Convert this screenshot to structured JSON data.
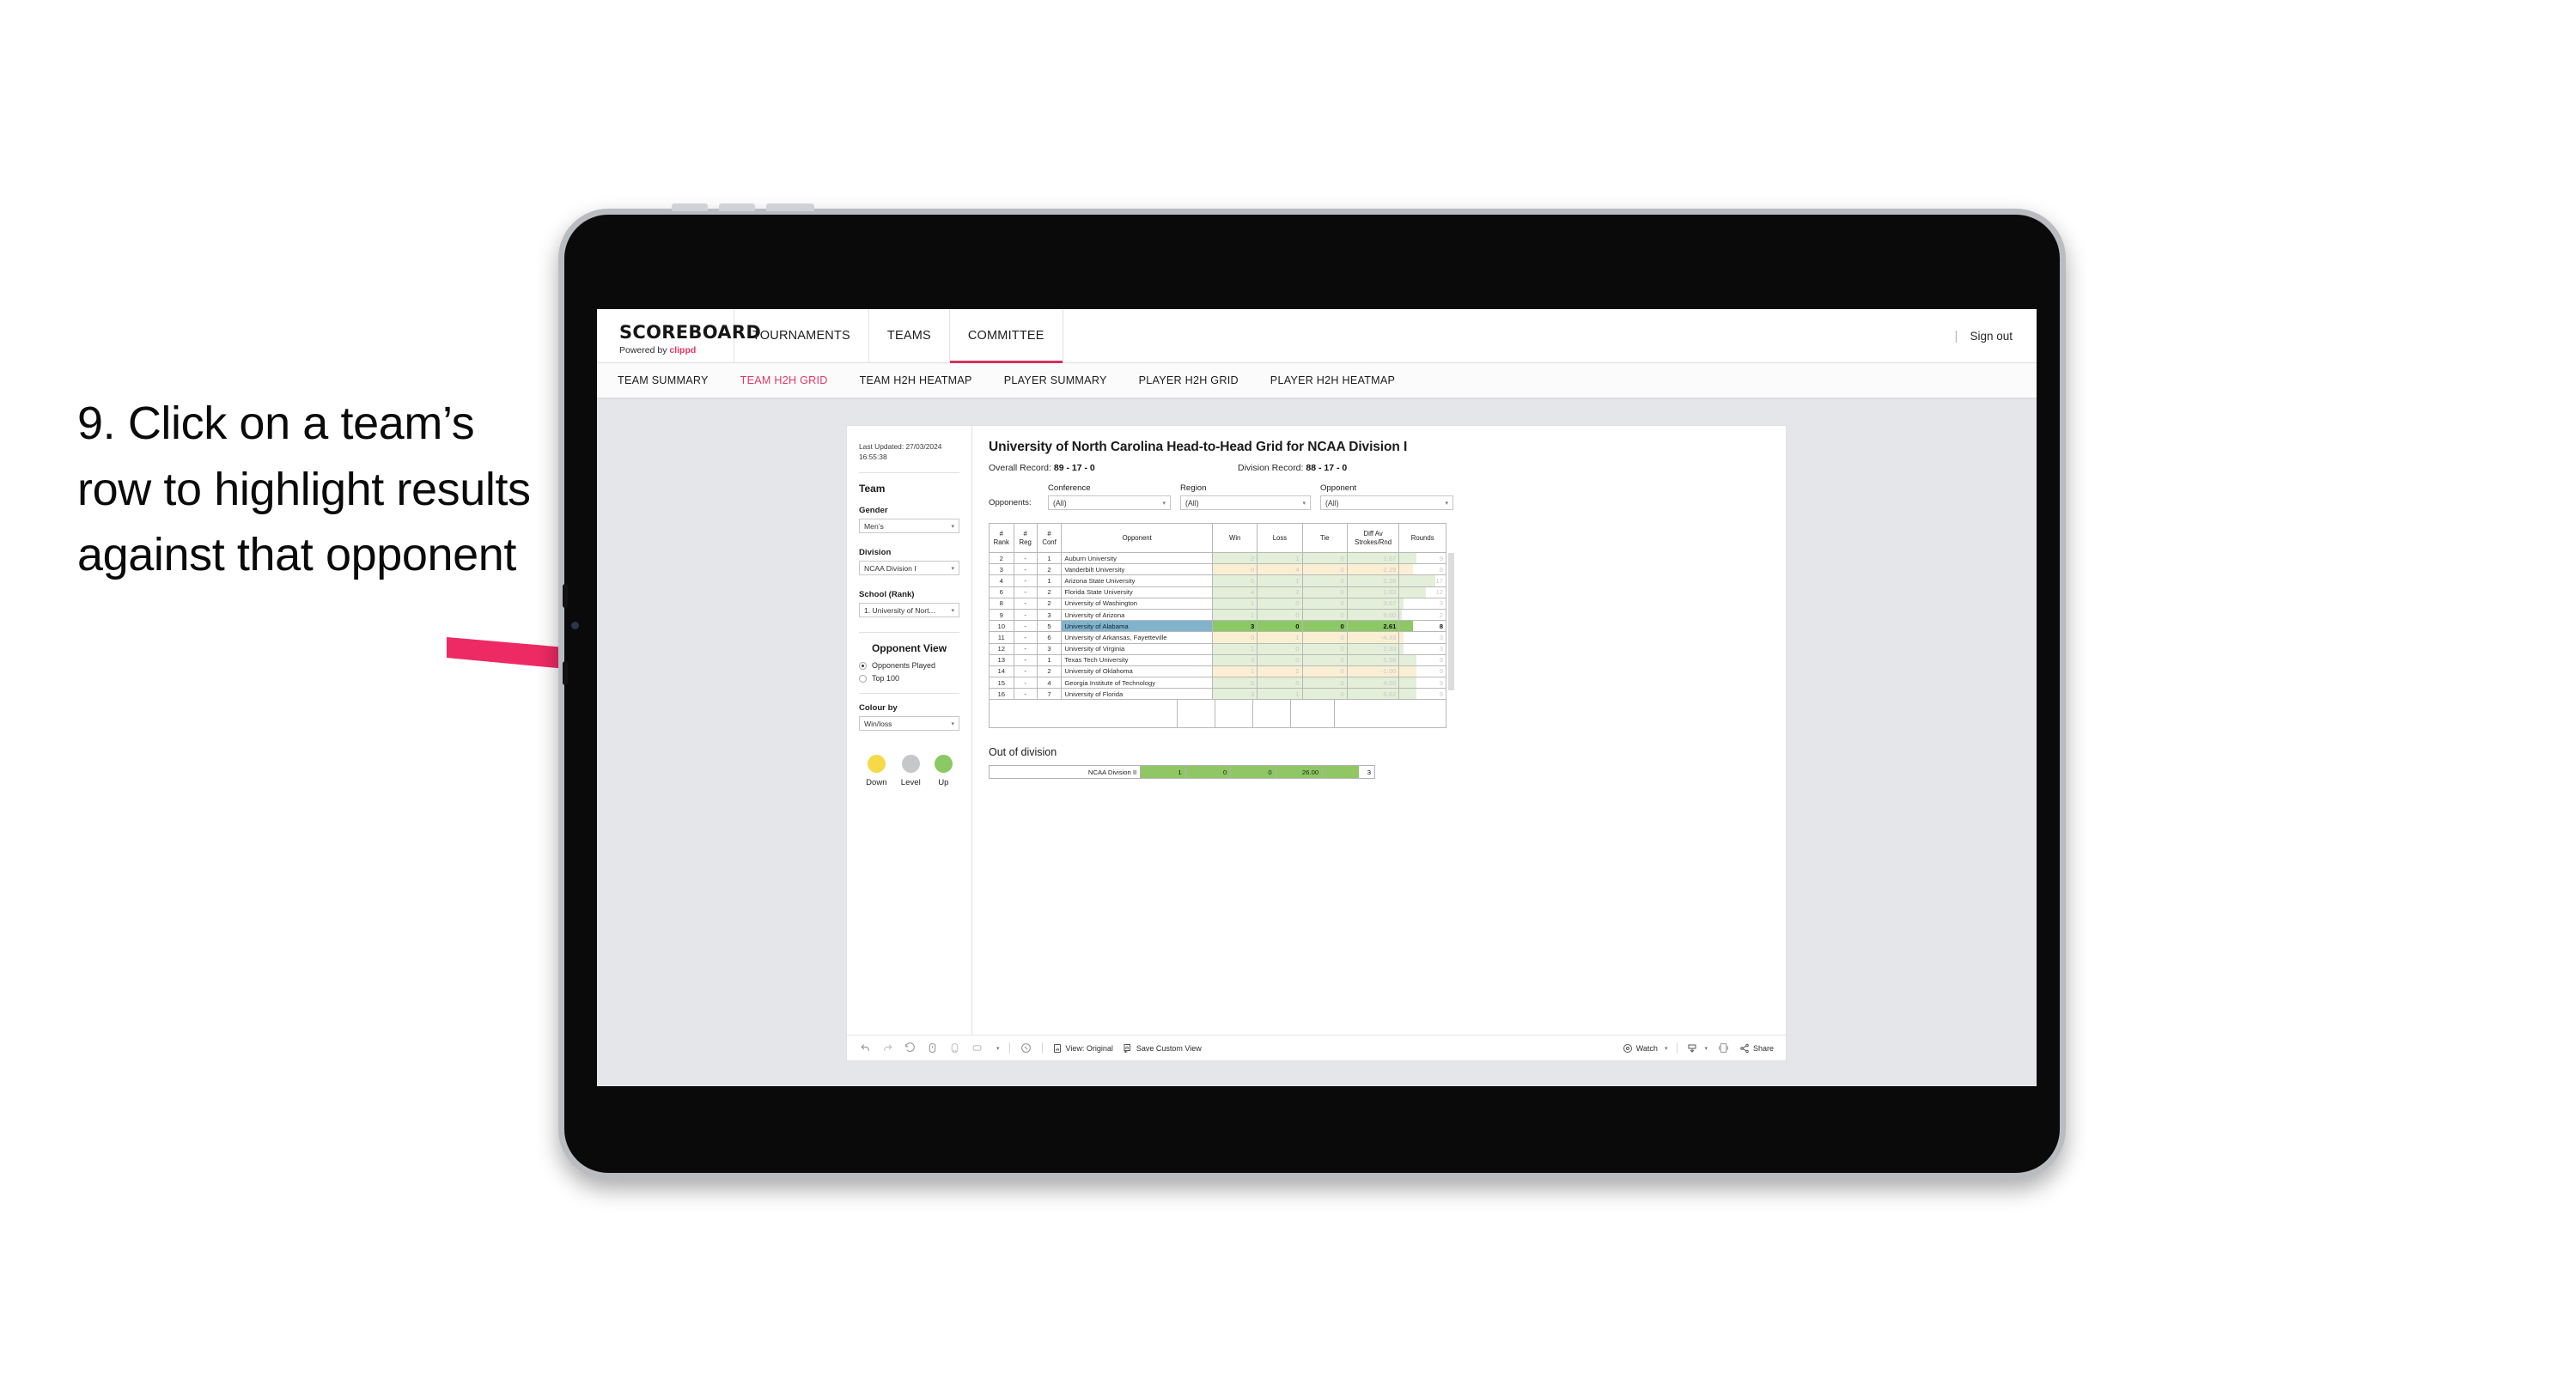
{
  "caption": {
    "text": "9. Click on a team’s row to highlight results against that opponent"
  },
  "colors": {
    "accent_pink": "#e0386a",
    "arrow_pink": "#ED2A63",
    "selected_row_blue": "#81b3cd",
    "bar_green": "#9ccb5e",
    "legend_down": "#f5d949",
    "legend_level": "#c6c7c9",
    "legend_up": "#8cc863"
  },
  "appbar": {
    "logo": "SCOREBOARD",
    "logo_sub_prefix": "Powered by ",
    "logo_sub_brand": "clippd",
    "tabs": [
      {
        "label": "TOURNAMENTS",
        "active": false
      },
      {
        "label": "TEAMS",
        "active": false
      },
      {
        "label": "COMMITTEE",
        "active": true
      }
    ],
    "divider": "|",
    "signout": "Sign out"
  },
  "subnav": {
    "tabs": [
      {
        "label": "TEAM SUMMARY",
        "active": false
      },
      {
        "label": "TEAM H2H GRID",
        "active": true
      },
      {
        "label": "TEAM H2H HEATMAP",
        "active": false
      },
      {
        "label": "PLAYER SUMMARY",
        "active": false
      },
      {
        "label": "PLAYER H2H GRID",
        "active": false
      },
      {
        "label": "PLAYER H2H HEATMAP",
        "active": false
      }
    ]
  },
  "filters": {
    "last_updated": "Last Updated: 27/03/2024 16:55:38",
    "team_heading": "Team",
    "gender_label": "Gender",
    "gender_value": "Men’s",
    "division_label": "Division",
    "division_value": "NCAA Division I",
    "school_label": "School (Rank)",
    "school_value": "1. University of Nort...",
    "opponent_view_heading": "Opponent View",
    "opponent_view_options": [
      {
        "label": "Opponents Played",
        "selected": true
      },
      {
        "label": "Top 100",
        "selected": false
      }
    ],
    "colour_by_label": "Colour by",
    "colour_by_value": "Win/loss",
    "legend": [
      {
        "label": "Down",
        "color": "#f5d949"
      },
      {
        "label": "Level",
        "color": "#c6c7c9"
      },
      {
        "label": "Up",
        "color": "#8cc863"
      }
    ]
  },
  "report": {
    "title": "University of North Carolina Head-to-Head Grid for NCAA Division I",
    "overall_record_label": "Overall Record: ",
    "overall_record_value": "89 - 17 - 0",
    "division_record_label": "Division Record: ",
    "division_record_value": "88 - 17 - 0",
    "opponents_label": "Opponents:",
    "opponent_filters": [
      {
        "label": "Conference",
        "value": "(All)"
      },
      {
        "label": "Region",
        "value": "(All)"
      },
      {
        "label": "Opponent",
        "value": "(All)"
      }
    ],
    "out_of_division_title": "Out of division"
  },
  "grid": {
    "columns": [
      "# Rank",
      "# Reg",
      "# Conf",
      "Opponent",
      "Win",
      "Loss",
      "Tie",
      "Diff Av Strokes/Rnd",
      "Rounds"
    ],
    "column_lines": {
      "rank": [
        "#",
        "Rank"
      ],
      "reg": [
        "#",
        "Reg"
      ],
      "conf": [
        "#",
        "Conf"
      ],
      "opponent": "Opponent",
      "win": "Win",
      "loss": "Loss",
      "tie": "Tie",
      "diff": [
        "Diff Av",
        "Strokes/Rnd"
      ],
      "rounds": "Rounds"
    },
    "rows": [
      {
        "rank": "2",
        "reg": "-",
        "conf": "1",
        "opponent": "Auburn University",
        "win": "2",
        "loss": "1",
        "tie": "0",
        "diff": "1.67",
        "rounds": "9",
        "tone": "up",
        "selected": false,
        "bar_pct": 36
      },
      {
        "rank": "3",
        "reg": "-",
        "conf": "2",
        "opponent": "Vanderbilt University",
        "win": "0",
        "loss": "4",
        "tie": "0",
        "diff": "-2.29",
        "rounds": "8",
        "tone": "down",
        "selected": false,
        "bar_pct": 30
      },
      {
        "rank": "4",
        "reg": "-",
        "conf": "1",
        "opponent": "Arizona State University",
        "win": "5",
        "loss": "1",
        "tie": "0",
        "diff": "2.28",
        "rounds": "17",
        "tone": "up",
        "selected": false,
        "bar_pct": 78
      },
      {
        "rank": "6",
        "reg": "-",
        "conf": "2",
        "opponent": "Florida State University",
        "win": "4",
        "loss": "2",
        "tie": "0",
        "diff": "1.83",
        "rounds": "12",
        "tone": "up",
        "selected": false,
        "bar_pct": 58
      },
      {
        "rank": "8",
        "reg": "-",
        "conf": "2",
        "opponent": "University of Washington",
        "win": "1",
        "loss": "0",
        "tie": "0",
        "diff": "3.67",
        "rounds": "3",
        "tone": "up",
        "selected": false,
        "bar_pct": 8
      },
      {
        "rank": "9",
        "reg": "-",
        "conf": "3",
        "opponent": "University of Arizona",
        "win": "1",
        "loss": "0",
        "tie": "0",
        "diff": "9.00",
        "rounds": "2",
        "tone": "up",
        "selected": false,
        "bar_pct": 5
      },
      {
        "rank": "10",
        "reg": "-",
        "conf": "5",
        "opponent": "University of Alabama",
        "win": "3",
        "loss": "0",
        "tie": "0",
        "diff": "2.61",
        "rounds": "8",
        "tone": "up",
        "selected": true,
        "bar_pct": 30
      },
      {
        "rank": "11",
        "reg": "-",
        "conf": "6",
        "opponent": "University of Arkansas, Fayetteville",
        "win": "0",
        "loss": "1",
        "tie": "0",
        "diff": "-4.33",
        "rounds": "3",
        "tone": "down",
        "selected": false,
        "bar_pct": 8
      },
      {
        "rank": "12",
        "reg": "-",
        "conf": "3",
        "opponent": "University of Virginia",
        "win": "1",
        "loss": "0",
        "tie": "0",
        "diff": "2.33",
        "rounds": "3",
        "tone": "up",
        "selected": false,
        "bar_pct": 8
      },
      {
        "rank": "13",
        "reg": "-",
        "conf": "1",
        "opponent": "Texas Tech University",
        "win": "3",
        "loss": "0",
        "tie": "0",
        "diff": "5.56",
        "rounds": "9",
        "tone": "up",
        "selected": false,
        "bar_pct": 36
      },
      {
        "rank": "14",
        "reg": "-",
        "conf": "2",
        "opponent": "University of Oklahoma",
        "win": "1",
        "loss": "2",
        "tie": "0",
        "diff": "-1.00",
        "rounds": "9",
        "tone": "down",
        "selected": false,
        "bar_pct": 36
      },
      {
        "rank": "15",
        "reg": "-",
        "conf": "4",
        "opponent": "Georgia Institute of Technology",
        "win": "5",
        "loss": "0",
        "tie": "0",
        "diff": "4.50",
        "rounds": "9",
        "tone": "up",
        "selected": false,
        "bar_pct": 36
      },
      {
        "rank": "16",
        "reg": "-",
        "conf": "7",
        "opponent": "University of Florida",
        "win": "3",
        "loss": "1",
        "tie": "0",
        "diff": "6.62",
        "rounds": "9",
        "tone": "up",
        "selected": false,
        "bar_pct": 36
      }
    ]
  },
  "out_of_division": {
    "rows": [
      {
        "name": "NCAA Division II",
        "win": "1",
        "loss": "0",
        "tie": "0",
        "diff": "26.00",
        "rounds": "3"
      }
    ]
  },
  "toolbar": {
    "icons": [
      "undo-icon",
      "redo-icon",
      "revert-icon",
      "refresh-icon",
      "pause-icon",
      "swap-icon"
    ],
    "view_label": "View: Original",
    "save_label": "Save Custom View",
    "watch_label": "Watch",
    "share_label": "Share"
  },
  "chart_data": {
    "type": "table",
    "title": "University of North Carolina Head-to-Head Grid for NCAA Division I",
    "categories": [
      "Auburn University",
      "Vanderbilt University",
      "Arizona State University",
      "Florida State University",
      "University of Washington",
      "University of Arizona",
      "University of Alabama",
      "University of Arkansas, Fayetteville",
      "University of Virginia",
      "Texas Tech University",
      "University of Oklahoma",
      "Georgia Institute of Technology",
      "University of Florida"
    ],
    "series": [
      {
        "name": "Win",
        "values": [
          2,
          0,
          5,
          4,
          1,
          1,
          3,
          0,
          1,
          3,
          1,
          5,
          3
        ]
      },
      {
        "name": "Loss",
        "values": [
          1,
          4,
          1,
          2,
          0,
          0,
          0,
          1,
          0,
          0,
          2,
          0,
          1
        ]
      },
      {
        "name": "Tie",
        "values": [
          0,
          0,
          0,
          0,
          0,
          0,
          0,
          0,
          0,
          0,
          0,
          0,
          0
        ]
      },
      {
        "name": "Diff Av Strokes/Rnd",
        "values": [
          1.67,
          -2.29,
          2.28,
          1.83,
          3.67,
          9.0,
          2.61,
          -4.33,
          2.33,
          5.56,
          -1.0,
          4.5,
          6.62
        ]
      },
      {
        "name": "Rounds",
        "values": [
          9,
          8,
          17,
          12,
          3,
          2,
          8,
          3,
          3,
          9,
          9,
          9,
          9
        ]
      }
    ],
    "legend": [
      "Down",
      "Level",
      "Up"
    ],
    "xlabel": "Opponent",
    "ylabel": ""
  }
}
